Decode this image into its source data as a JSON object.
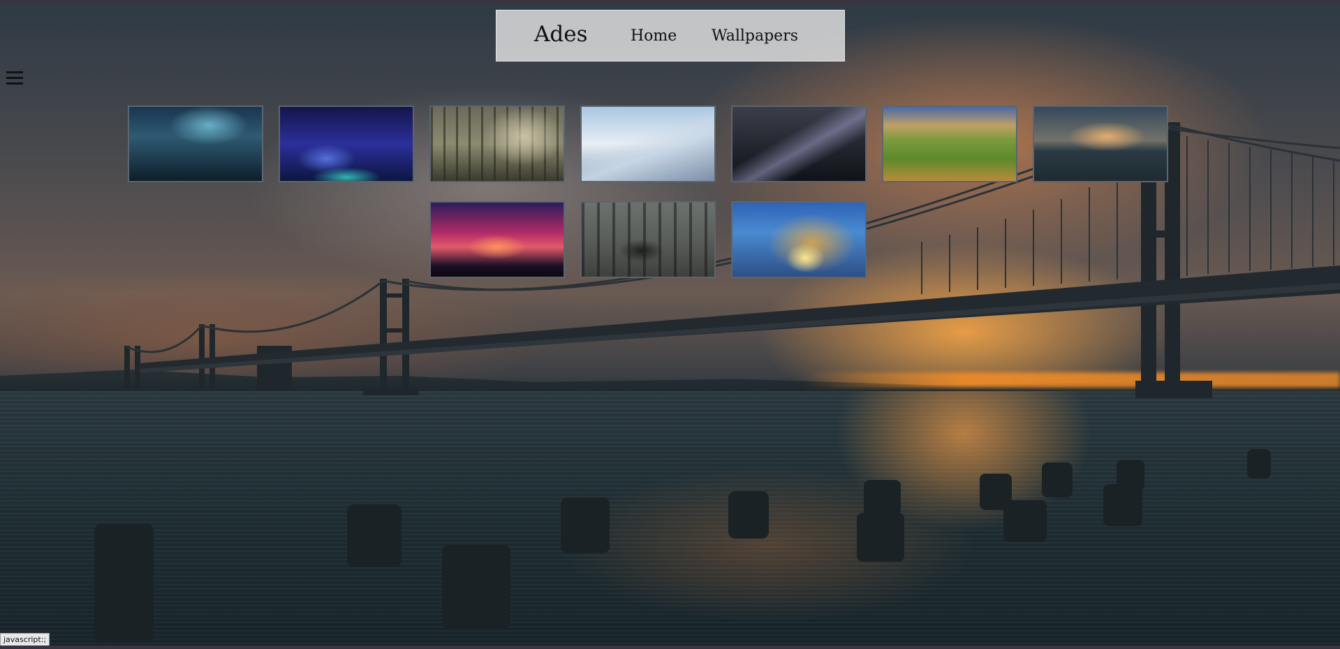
{
  "navbar": {
    "brand": "Ades",
    "links": [
      "Home",
      "Wallpapers"
    ]
  },
  "gallery": {
    "thumbnails": [
      {
        "name": "aurora-forest"
      },
      {
        "name": "starry-alien-landscape"
      },
      {
        "name": "misty-forest"
      },
      {
        "name": "snowy-mountains"
      },
      {
        "name": "milky-way-night"
      },
      {
        "name": "green-hills"
      },
      {
        "name": "bridge-sunset"
      },
      {
        "name": "tree-red-sky"
      },
      {
        "name": "sports-car-forest"
      },
      {
        "name": "ocean-wave"
      }
    ]
  },
  "statusbar": {
    "text": "javascript:;"
  },
  "background": {
    "description_icon": "bridge-sunset-background"
  },
  "colors": {
    "navbar_bg": "#ebebeb",
    "text": "#111111",
    "thumb_border": "#5a6670"
  }
}
